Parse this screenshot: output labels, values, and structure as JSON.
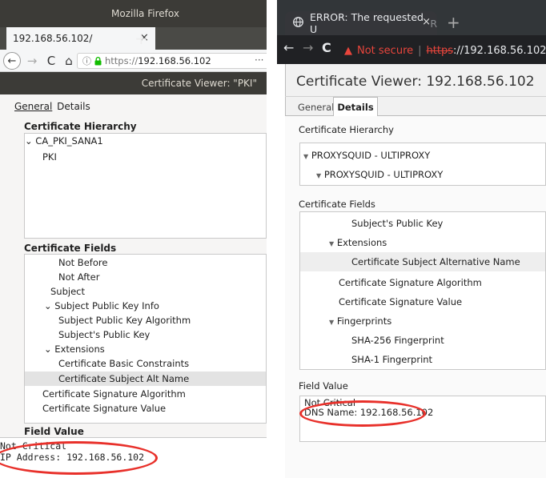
{
  "left": {
    "window_title": "Mozilla Firefox",
    "tab": {
      "title": "192.168.56.102/",
      "close_glyph": "×"
    },
    "new_tab_glyph": "+",
    "nav": {
      "back": "←",
      "forward": "→",
      "reload": "C",
      "home": "⌂",
      "more": "···"
    },
    "url": {
      "prefix": "https://",
      "host": "192.168.56.102"
    },
    "dialog_title": "Certificate Viewer: \"PKI\"",
    "tabs": [
      {
        "label": "General"
      },
      {
        "label": "Details"
      }
    ],
    "hierarchy_label": "Certificate Hierarchy",
    "hierarchy": [
      {
        "label": "CA_PKI_SANA1",
        "toggle": "⌄"
      },
      {
        "label": "PKI"
      }
    ],
    "fields_label": "Certificate Fields",
    "fields": [
      {
        "label": "Not Before"
      },
      {
        "label": "Not After"
      },
      {
        "label": "Subject"
      },
      {
        "label": "Subject Public Key Info",
        "toggle": "⌄"
      },
      {
        "label": "Subject Public Key Algorithm"
      },
      {
        "label": "Subject's Public Key"
      },
      {
        "label": "Extensions",
        "toggle": "⌄"
      },
      {
        "label": "Certificate Basic Constraints"
      },
      {
        "label": "Certificate Subject Alt Name",
        "selected": true
      },
      {
        "label": "Certificate Signature Algorithm"
      },
      {
        "label": "Certificate Signature Value"
      }
    ],
    "field_value_label": "Field Value",
    "field_value_lines": [
      "Not Critical",
      "IP Address: 192.168.56.102"
    ]
  },
  "right": {
    "tab_title": "ERROR: The requested U",
    "tab_title_fade": "R",
    "tab_close": "×",
    "new_tab_glyph": "+",
    "nav": {
      "back": "←",
      "forward": "→",
      "reload": "C"
    },
    "omnibox": {
      "warning": "Not secure",
      "separator": "|",
      "scheme": "https",
      "host": "://192.168.56.102"
    },
    "dialog_title": "Certificate Viewer: 192.168.56.102",
    "tabs": [
      {
        "label": "General"
      },
      {
        "label": "Details",
        "selected": true
      }
    ],
    "hierarchy_label": "Certificate Hierarchy",
    "hierarchy": [
      {
        "label": "PROXYSQUID - ULTIPROXY",
        "toggle": "▼"
      },
      {
        "label": "PROXYSQUID - ULTIPROXY",
        "toggle": "▼"
      }
    ],
    "fields_label": "Certificate Fields",
    "fields": [
      {
        "label": "Subject's Public Key"
      },
      {
        "label": "Extensions",
        "toggle": "▼"
      },
      {
        "label": "Certificate Subject Alternative Name",
        "selected": true
      },
      {
        "label": "Certificate Signature Algorithm"
      },
      {
        "label": "Certificate Signature Value"
      },
      {
        "label": "Fingerprints",
        "toggle": "▼"
      },
      {
        "label": "SHA-256 Fingerprint"
      },
      {
        "label": "SHA-1 Fingerprint"
      }
    ],
    "field_value_label": "Field Value",
    "field_value_lines": [
      "Not Critical",
      "DNS Name: 192.168.56.102"
    ]
  },
  "annotation_color": "#e8302a"
}
